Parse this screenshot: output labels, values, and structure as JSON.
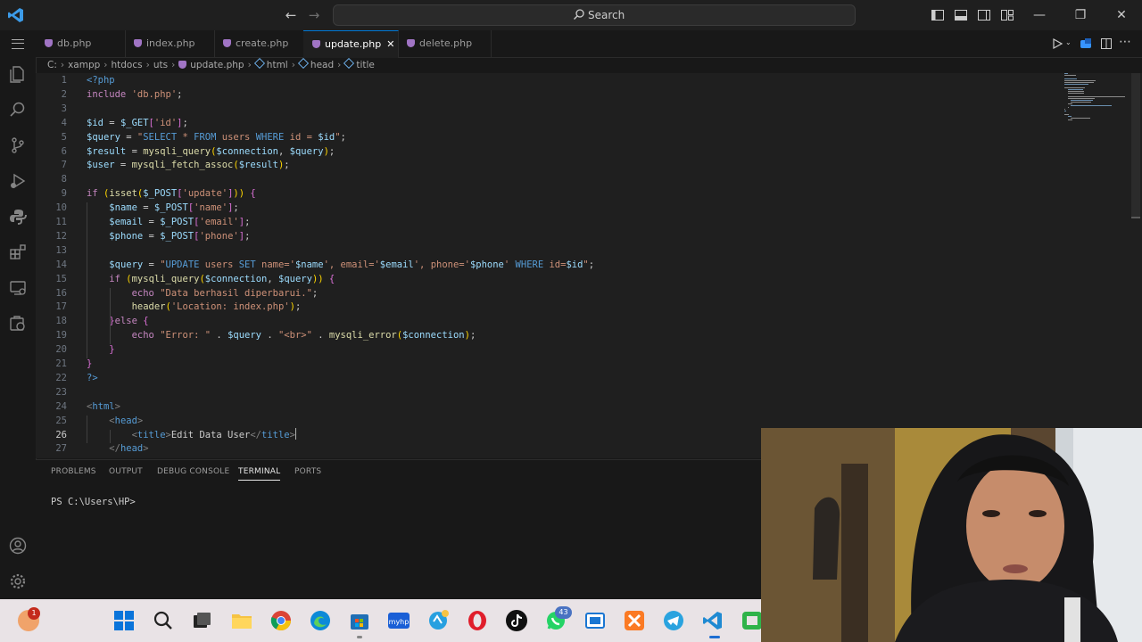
{
  "titlebar": {
    "search_placeholder": "Search"
  },
  "tabs": [
    {
      "label": "db.php"
    },
    {
      "label": "index.php"
    },
    {
      "label": "create.php"
    },
    {
      "label": "update.php",
      "active": true
    },
    {
      "label": "delete.php"
    }
  ],
  "breadcrumb": {
    "parts": [
      "C:",
      "xampp",
      "htdocs",
      "uts",
      "update.php",
      "html",
      "head",
      "title"
    ]
  },
  "editor": {
    "current_line": 26,
    "lines": [
      {
        "n": "1",
        "c": "<?php"
      },
      {
        "n": "2",
        "c": "include 'db.php';"
      },
      {
        "n": "3",
        "c": ""
      },
      {
        "n": "4",
        "c": "$id = $_GET['id'];"
      },
      {
        "n": "5",
        "c": "$query = \"SELECT * FROM users WHERE id = $id\";"
      },
      {
        "n": "6",
        "c": "$result = mysqli_query($connection, $query);"
      },
      {
        "n": "7",
        "c": "$user = mysqli_fetch_assoc($result);"
      },
      {
        "n": "8",
        "c": ""
      },
      {
        "n": "9",
        "c": "if (isset($_POST['update'])) {"
      },
      {
        "n": "10",
        "c": "    $name = $_POST['name'];"
      },
      {
        "n": "11",
        "c": "    $email = $_POST['email'];"
      },
      {
        "n": "12",
        "c": "    $phone = $_POST['phone'];"
      },
      {
        "n": "13",
        "c": ""
      },
      {
        "n": "14",
        "c": "    $query = \"UPDATE users SET name='$name', email='$email', phone='$phone' WHERE id=$id\";"
      },
      {
        "n": "15",
        "c": "    if (mysqli_query($connection, $query)) {"
      },
      {
        "n": "16",
        "c": "        echo \"Data berhasil diperbarui.\";"
      },
      {
        "n": "17",
        "c": "        header('Location: index.php');"
      },
      {
        "n": "18",
        "c": "    }else {"
      },
      {
        "n": "19",
        "c": "        echo \"Error: \" . $query . \"<br>\" . mysqli_error($connection);"
      },
      {
        "n": "20",
        "c": "    }"
      },
      {
        "n": "21",
        "c": "}"
      },
      {
        "n": "22",
        "c": "?>"
      },
      {
        "n": "23",
        "c": ""
      },
      {
        "n": "24",
        "c": "<html>"
      },
      {
        "n": "25",
        "c": "    <head>"
      },
      {
        "n": "26",
        "c": "        <title>Edit Data User</title>"
      },
      {
        "n": "27",
        "c": "    </head>"
      }
    ]
  },
  "panel": {
    "tabs": [
      "PROBLEMS",
      "OUTPUT",
      "DEBUG CONSOLE",
      "TERMINAL",
      "PORTS"
    ],
    "active_tab": "TERMINAL",
    "terminal_prompt": "PS C:\\Users\\HP>"
  },
  "taskbar": {
    "badges": {
      "home": "1",
      "whatsapp": "43"
    }
  },
  "colors": {
    "editor_bg": "#1f1f1f",
    "accent": "#0078d4",
    "taskbar_bg": "#e9e3e6"
  }
}
